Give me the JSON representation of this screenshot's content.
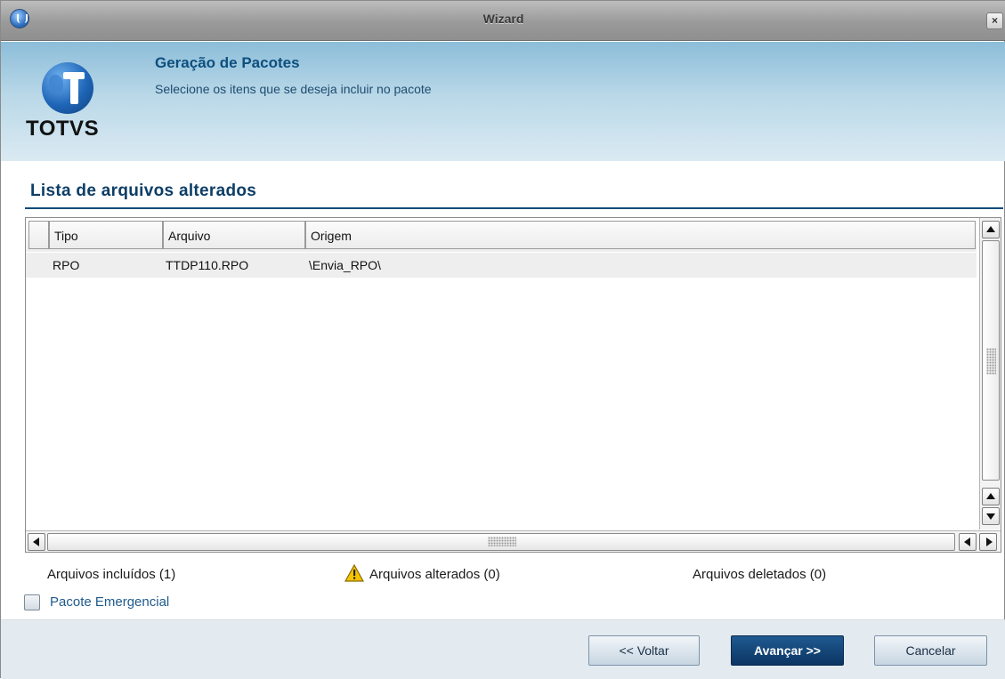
{
  "window": {
    "title": "Wizard",
    "close_glyph": "×"
  },
  "header": {
    "logo_text": "TOTVS",
    "title": "Geração de Pacotes",
    "subtitle": "Selecione os itens que se deseja incluir no pacote"
  },
  "section": {
    "title": "Lista de arquivos alterados"
  },
  "grid": {
    "columns": [
      "Tipo",
      "Arquivo",
      "Origem"
    ],
    "rows": [
      {
        "tipo": "RPO",
        "arquivo": "TTDP110.RPO",
        "origem": "\\Envia_RPO\\"
      }
    ]
  },
  "status": {
    "included": "Arquivos incluídos (1)",
    "altered": "Arquivos alterados (0)",
    "deleted": "Arquivos deletados (0)"
  },
  "options": {
    "emergency_label": "Pacote Emergencial",
    "emergency_checked": false
  },
  "buttons": {
    "back": "<< Voltar",
    "next": "Avançar >>",
    "cancel": "Cancelar"
  },
  "colors": {
    "accent": "#0e4a78",
    "primary_button": "#0b3462",
    "header_band": "#b9d8e8"
  }
}
